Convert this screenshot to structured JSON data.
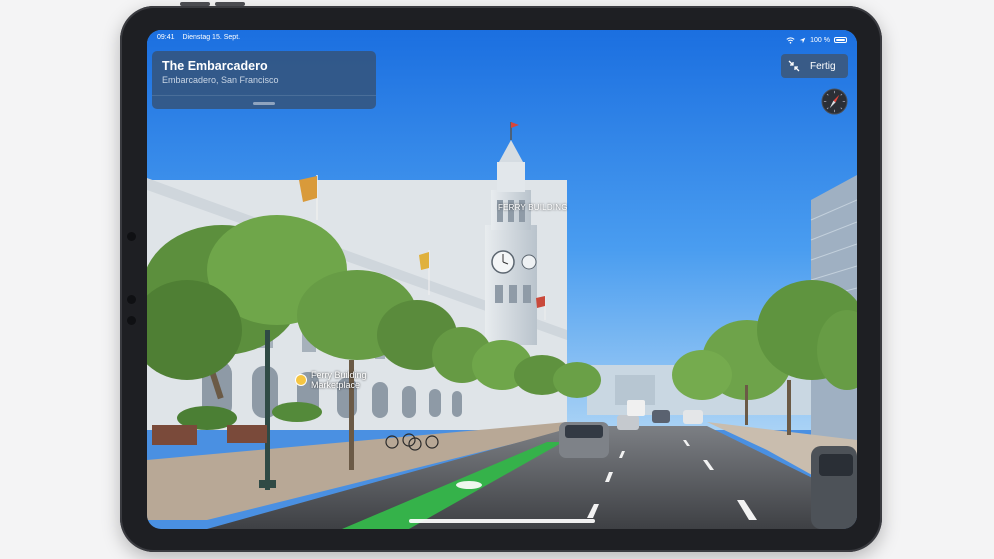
{
  "status_bar": {
    "time": "09:41",
    "date": "Dienstag 15. Sept.",
    "battery": "100 %"
  },
  "place_card": {
    "title": "The Embarcadero",
    "subtitle": "Embarcadero, San Francisco"
  },
  "done_button": {
    "label": "Fertig"
  },
  "scene_labels": {
    "landmark": "FERRY BUILDING",
    "poi": "Ferry Building\nMarketplace"
  },
  "icons": {
    "collapse": "collapse-arrows-icon",
    "compass": "compass-icon",
    "wifi": "wifi-icon",
    "location": "location-arrow-icon",
    "battery": "battery-icon",
    "poi": "poi-marker-icon"
  },
  "colors": {
    "sky": "#2f86e8",
    "bike_lane": "#35b24a",
    "poi_marker": "#f5c542",
    "device_frame": "#1e1f23",
    "panel": "#34547c"
  }
}
